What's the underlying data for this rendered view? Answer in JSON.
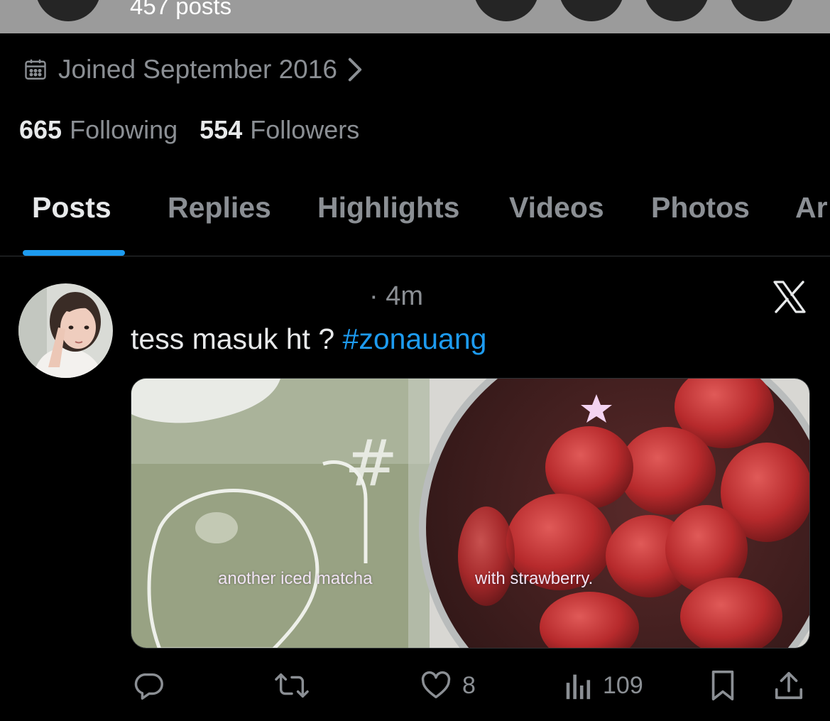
{
  "header": {
    "post_count": "457 posts"
  },
  "profile": {
    "joined": "Joined September 2016",
    "following_count": "665",
    "following_label": "Following",
    "followers_count": "554",
    "followers_label": "Followers"
  },
  "tabs": [
    {
      "label": "Posts",
      "active": true
    },
    {
      "label": "Replies"
    },
    {
      "label": "Highlights"
    },
    {
      "label": "Videos"
    },
    {
      "label": "Photos"
    },
    {
      "label": "Ar"
    }
  ],
  "post": {
    "time": "· 4m",
    "text": "tess masuk ht ? ",
    "hashtag": "#zonauang",
    "image_captions": [
      "another iced matcha",
      "with strawberry."
    ],
    "likes": "8",
    "views": "109"
  },
  "colors": {
    "accent": "#1d9bf0",
    "muted": "#8b8f94",
    "text": "#e7e9ea"
  },
  "icons": [
    "calendar-icon",
    "chevron-right-icon",
    "x-logo-icon",
    "reply-icon",
    "repost-icon",
    "like-icon",
    "views-icon",
    "bookmark-icon",
    "share-icon"
  ]
}
